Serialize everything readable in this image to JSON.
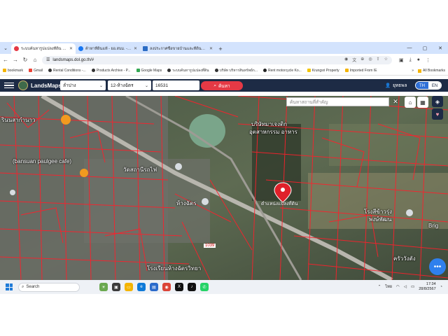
{
  "browser": {
    "tabs": [
      {
        "title": "ระบบค้นหารูปแปลงที่ดิน (LandsMa",
        "color": "#e53945",
        "active": true
      },
      {
        "title": "ค้าหาที่ดินแท้ - ยอ.สบม. - แผลราภ",
        "color": "#1877f2",
        "active": false
      },
      {
        "title": "ลงประกาศซื้อขายบ้านและที่ดินฟรี |",
        "color": "#2b6cc4",
        "active": false
      }
    ],
    "new_tab": "+",
    "url": "landsmaps.dol.go.th/#",
    "bookmarks": [
      {
        "label": "bookmark",
        "color": "#f4b400"
      },
      {
        "label": "Gmail",
        "color": "#ea4335"
      },
      {
        "label": "Rental Conditions -...",
        "color": "#333333"
      },
      {
        "label": "Products Archive - P...",
        "color": "#333333"
      },
      {
        "label": "Google Maps",
        "color": "#34a853"
      },
      {
        "label": "ระบบค้นหารูปแปลงที่ดิน",
        "color": "#e53945"
      },
      {
        "label": "บริษัท บริหารสินทรัพย์ก...",
        "color": "#333333"
      },
      {
        "label": "Rent motorcycle Ko...",
        "color": "#222222"
      },
      {
        "label": "Krungsri Property",
        "color": "#f2c500"
      },
      {
        "label": "Imported From IE",
        "color": "#f4b400"
      }
    ],
    "all_bookmarks": "All Bookmarks"
  },
  "site": {
    "brand": "LandsMaps",
    "province": "ลำปาง",
    "district": "12-ห้างฉัตร",
    "parcel_no": "16531",
    "search_label": "ค้นหา",
    "user": "ยุทธพล",
    "lang_th": "TH",
    "lang_en": "EN"
  },
  "map": {
    "place_search_placeholder": "ค้นหาสถานที่สำคัญ",
    "labels": [
      {
        "text": "รินนสากำนาว",
        "cls": "l1"
      },
      {
        "text": "(bansuan paulgee cafe)",
        "cls": "l2"
      },
      {
        "text": "วัดสถานีรถไฟ",
        "cls": "l3"
      },
      {
        "text": "ห้างฉัตร",
        "cls": "l4"
      },
      {
        "text": "บริษัทมาเจงติก",
        "cls": "l5"
      },
      {
        "text": "อุตสาหกรรม อาหาร",
        "cls": "l6"
      },
      {
        "text": "โรงสีข้าวรุ่ง",
        "cls": "l7"
      },
      {
        "text": "พงษ์พัฒน",
        "cls": "l8"
      },
      {
        "text": "Brig",
        "cls": "l9"
      },
      {
        "text": "ครัววังตัง",
        "cls": "l10"
      },
      {
        "text": "โรงเรียนห้างฉัตรวิทยา",
        "cls": "l11"
      },
      {
        "text": "1039",
        "cls": "l12"
      }
    ],
    "pin_label": "ตำแหน่งแปลงที่ดิน"
  },
  "taskbar": {
    "search": "Search",
    "tray_lang": "ไทย",
    "time": "17:34",
    "date": "28/8/2567"
  }
}
